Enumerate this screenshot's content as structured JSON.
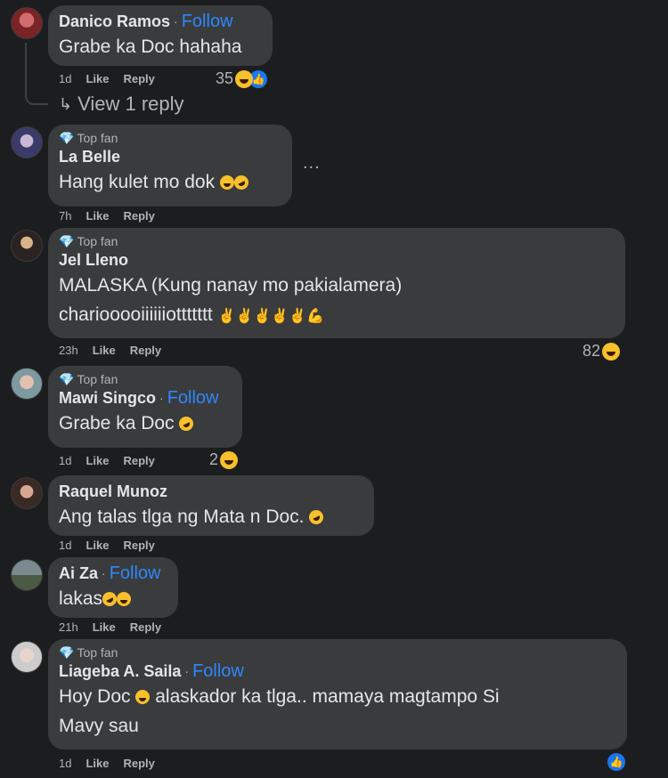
{
  "comments": [
    {
      "name": "Danico Ramos",
      "follow": "Follow",
      "text": "Grabe ka Doc hahaha",
      "time": "1d",
      "like": "Like",
      "reply": "Reply",
      "reaction_count": "35",
      "reactions": [
        "laughing-emoji",
        "like-icon"
      ],
      "view_replies": "View 1 reply"
    },
    {
      "badge": "Top fan",
      "name": "La Belle",
      "text": "Hang kulet mo dok",
      "time": "7h",
      "like": "Like",
      "reply": "Reply",
      "more": "..."
    },
    {
      "badge": "Top fan",
      "name": "Jel Lleno",
      "text_line1": "MALASKA (Kung nanay mo pakialamera)",
      "text_line2": "chariooooiiiiiiottttttt",
      "time": "23h",
      "like": "Like",
      "reply": "Reply",
      "reaction_count": "82"
    },
    {
      "badge": "Top fan",
      "name": "Mawi Singco",
      "follow": "Follow",
      "text": "Grabe ka Doc",
      "time": "1d",
      "like": "Like",
      "reply": "Reply",
      "reaction_count": "2"
    },
    {
      "name": "Raquel Munoz",
      "text": "Ang talas tlga ng Mata n Doc.",
      "time": "1d",
      "like": "Like",
      "reply": "Reply"
    },
    {
      "name": "Ai Za",
      "follow": "Follow",
      "text": "lakas",
      "time": "21h",
      "like": "Like",
      "reply": "Reply"
    },
    {
      "badge": "Top fan",
      "name": "Liageba A. Saila",
      "follow": "Follow",
      "text_part1": "Hoy Doc",
      "text_part2": "alaskador ka tlga.. mamaya magtampo Si",
      "text_line2": "Mavy sau",
      "time": "1d",
      "like": "Like",
      "reply": "Reply"
    }
  ],
  "colors": {
    "background": "#1c1d1f",
    "bubble": "#3a3b3c",
    "follow": "#2d88ff",
    "secondary_text": "#b0b3b8"
  }
}
